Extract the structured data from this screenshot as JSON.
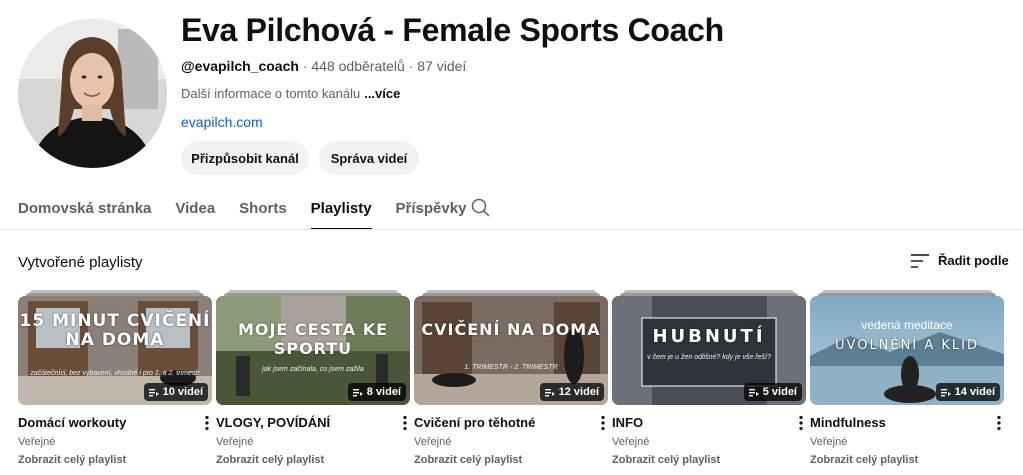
{
  "channel": {
    "title": "Eva Pilchová - Female Sports Coach",
    "handle": "@evapilch_coach",
    "subscribers": "448 odběratelů",
    "videos": "87 videí",
    "description": "Další informace o tomto kanálu",
    "more": "...více",
    "link": "evapilch.com",
    "customize_label": "Přizpůsobit kanál",
    "manage_label": "Správa videí",
    "separator": "·"
  },
  "tabs": [
    {
      "label": "Domovská stránka",
      "active": false
    },
    {
      "label": "Videa",
      "active": false
    },
    {
      "label": "Shorts",
      "active": false
    },
    {
      "label": "Playlisty",
      "active": true
    },
    {
      "label": "Příspěvky",
      "active": false
    }
  ],
  "section": {
    "title": "Vytvořené playlisty",
    "sort_label": "Řadit podle"
  },
  "playlists": [
    {
      "title": "Domácí workouty",
      "count": "10 videí",
      "privacy": "Veřejné",
      "view_label": "Zobrazit celý playlist",
      "thumb_text": "15 MINUT CVIČENÍ NA DOMA",
      "thumb_sub": "začátečníci, bez vybavení, vhodné i pro 1. a 2. trimestr"
    },
    {
      "title": "VLOGY, POVÍDÁNÍ",
      "count": "8 videí",
      "privacy": "Veřejné",
      "view_label": "Zobrazit celý playlist",
      "thumb_text": "MOJE CESTA KE SPORTU",
      "thumb_sub": "jak jsem začínala, co jsem zažila"
    },
    {
      "title": "Cvičení pro těhotné",
      "count": "12 videí",
      "privacy": "Veřejné",
      "view_label": "Zobrazit celý playlist",
      "thumb_text": "CVIČENÍ NA DOMA",
      "thumb_sub": "1. TRIMESTR - 2. TRIMESTR"
    },
    {
      "title": "INFO",
      "count": "5 videí",
      "privacy": "Veřejné",
      "view_label": "Zobrazit celý playlist",
      "thumb_text": "HUBNUTÍ",
      "thumb_sub": "v čem je u žen odlišné? kdy je vše řeší?"
    },
    {
      "title": "Mindfulness",
      "count": "14 videí",
      "privacy": "Veřejné",
      "view_label": "Zobrazit celý playlist",
      "thumb_text": "UVOLNĚNÍ A KLID",
      "thumb_sub": "vedená meditace"
    }
  ],
  "icons": {
    "search": "search-icon",
    "sort": "sort-icon",
    "playlist": "playlist-icon",
    "menu": "more-vert-icon"
  },
  "colors": {
    "link": "#065fd4",
    "button_bg": "#f2f2f2",
    "text_secondary": "#606060"
  }
}
